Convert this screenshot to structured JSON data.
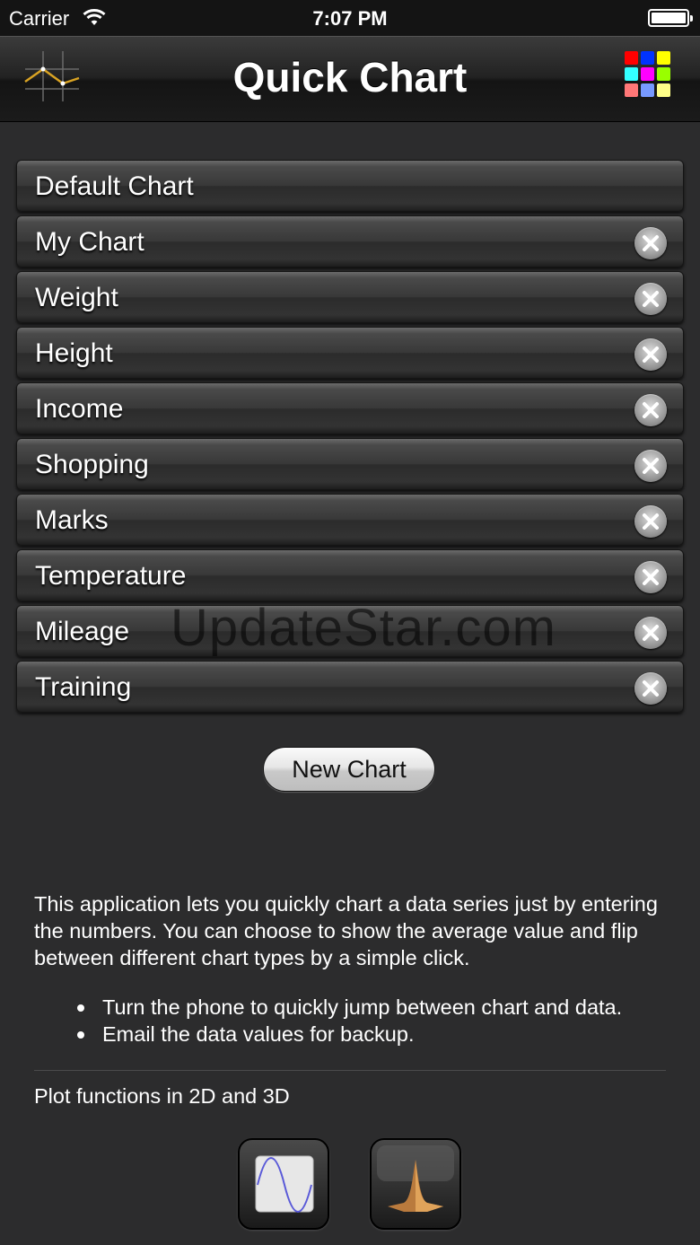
{
  "status_bar": {
    "carrier": "Carrier",
    "time": "7:07 PM"
  },
  "nav": {
    "title": "Quick Chart",
    "left_icon": "line-chart-icon",
    "right_icon": "color-grid-icon",
    "grid_colors": [
      "#ff0000",
      "#0033ff",
      "#ffff00",
      "#33ffff",
      "#ff00ff",
      "#99ff00",
      "#ff7777",
      "#7799ff",
      "#ffff88"
    ]
  },
  "charts": [
    {
      "label": "Default Chart",
      "deletable": false
    },
    {
      "label": "My Chart",
      "deletable": true
    },
    {
      "label": "Weight",
      "deletable": true
    },
    {
      "label": "Height",
      "deletable": true
    },
    {
      "label": "Income",
      "deletable": true
    },
    {
      "label": "Shopping",
      "deletable": true
    },
    {
      "label": "Marks",
      "deletable": true
    },
    {
      "label": "Temperature",
      "deletable": true
    },
    {
      "label": "Mileage",
      "deletable": true
    },
    {
      "label": "Training",
      "deletable": true
    }
  ],
  "watermark": "UpdateStar.com",
  "new_chart_label": "New Chart",
  "description": "This application lets you quickly chart a data series just by entering the numbers. You can choose to show the average value and flip between different chart types by a simple click.",
  "bullets": [
    "Turn the phone to quickly jump between chart and data.",
    "Email the data values for backup."
  ],
  "plot_label": "Plot functions in 2D and 3D",
  "apps": [
    {
      "icon": "sine-wave-2d-plot-icon"
    },
    {
      "icon": "3d-surface-peak-icon"
    }
  ]
}
